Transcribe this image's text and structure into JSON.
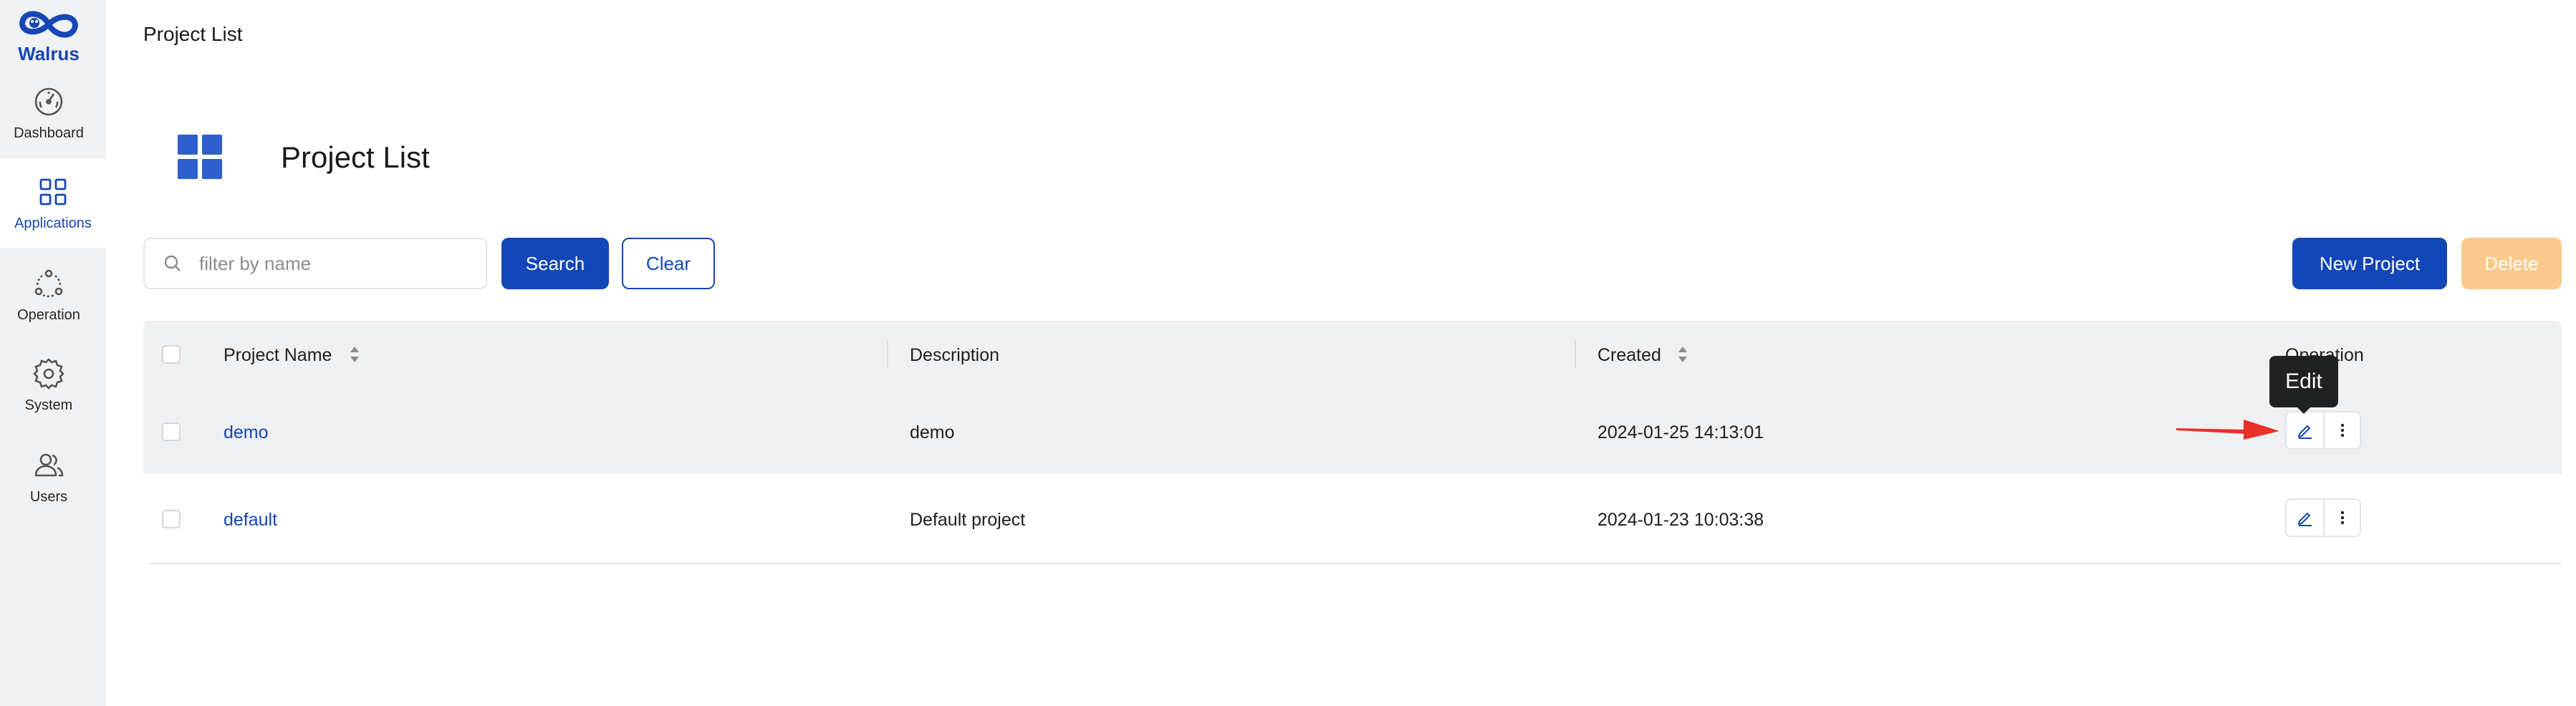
{
  "app": {
    "logo_text": "Walrus",
    "brand_color": "#1346b8"
  },
  "sidebar": {
    "items": [
      {
        "label": "Dashboard",
        "icon": "dashboard-icon",
        "active": false
      },
      {
        "label": "Applications",
        "icon": "applications-grid-icon",
        "active": true
      },
      {
        "label": "Operation",
        "icon": "operation-icon",
        "active": false
      },
      {
        "label": "System",
        "icon": "gear-icon",
        "active": false
      },
      {
        "label": "Users",
        "icon": "users-icon",
        "active": false
      }
    ]
  },
  "breadcrumb": {
    "title": "Project List"
  },
  "header": {
    "title": "Project List",
    "icon": "windows-grid-icon"
  },
  "toolbar": {
    "search_placeholder": "filter by name",
    "search_value": "",
    "search_label": "Search",
    "clear_label": "Clear",
    "new_label": "New Project",
    "delete_label": "Delete",
    "delete_color": "#fbc98a"
  },
  "table": {
    "columns": [
      "Project Name",
      "Description",
      "Created",
      "Operation"
    ],
    "rows": [
      {
        "name": "demo",
        "description": "demo",
        "created": "2024-01-25 14:13:01"
      },
      {
        "name": "default",
        "description": "Default project",
        "created": "2024-01-23 10:03:38"
      }
    ]
  },
  "tooltip": {
    "text": "Edit"
  },
  "annotation": {
    "arrow_color": "#e8302a"
  }
}
